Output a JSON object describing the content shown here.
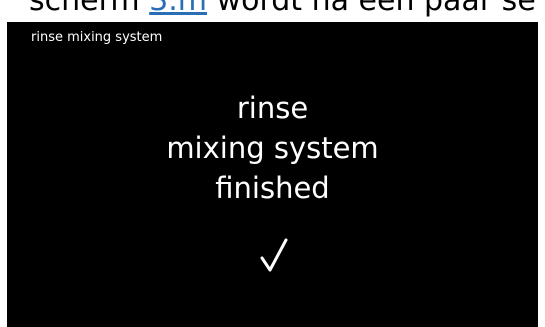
{
  "document": {
    "text_before_link": "scherm ",
    "link_text": "3.m",
    "text_after_link": " wordt na een paar se"
  },
  "screen": {
    "title": "rinse mixing system",
    "message_lines": [
      "rinse",
      "mixing system",
      "finished"
    ],
    "status_icon": "checkmark-icon",
    "background": "#000000",
    "foreground": "#ffffff"
  }
}
